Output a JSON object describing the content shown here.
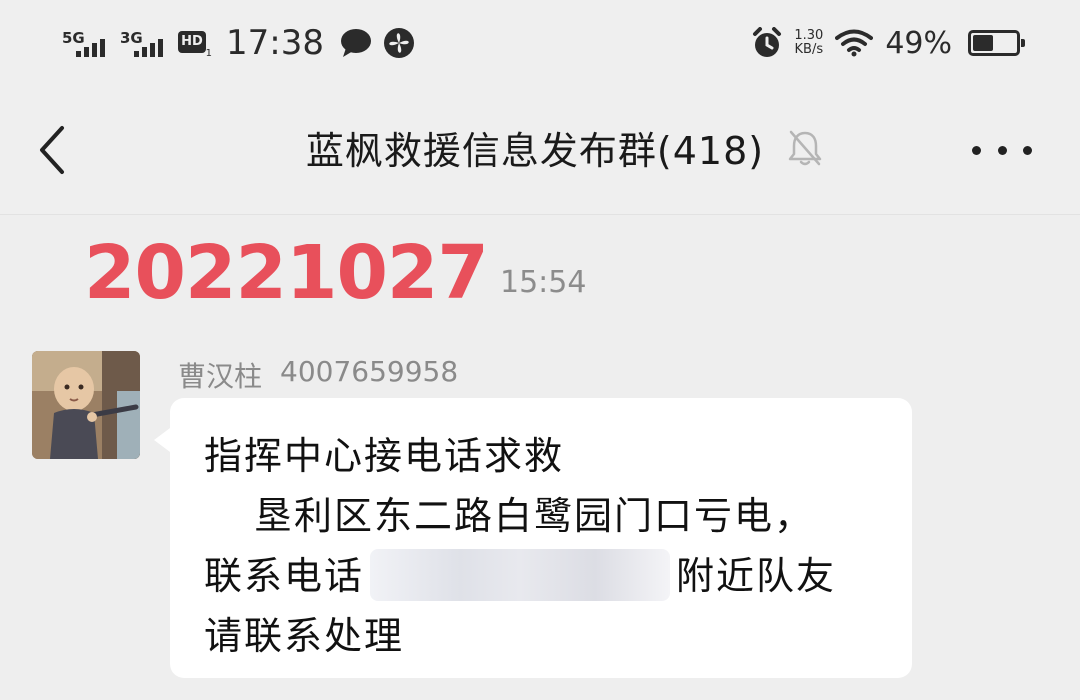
{
  "status_bar": {
    "signal1": "5G",
    "signal2": "3G",
    "hd_label": "HD",
    "hd_sub": "1",
    "time": "17:38",
    "net_speed_value": "1.30",
    "net_speed_unit": "KB/s",
    "battery_percent": "49%",
    "battery_level": 0.49
  },
  "header": {
    "title": "蓝枫救援信息发布群(418)",
    "mute_icon": "bell-muted-icon",
    "back_icon": "chevron-left-icon",
    "more_icon": "more-dots-icon"
  },
  "chat": {
    "date_banner": "20221027",
    "banner_time": "15:54",
    "message": {
      "sender_name": "曹汉柱",
      "sender_id": "4007659958",
      "line1": "指挥中心接电话求救",
      "line2": "垦利区东二路白鹭园门口亏电，",
      "line3_prefix": "联系电话",
      "line3_suffix": "附近队友",
      "line4": "请联系处理"
    }
  },
  "colors": {
    "date_banner": "#e8505b",
    "background": "#eeeeee",
    "bubble": "#ffffff"
  }
}
